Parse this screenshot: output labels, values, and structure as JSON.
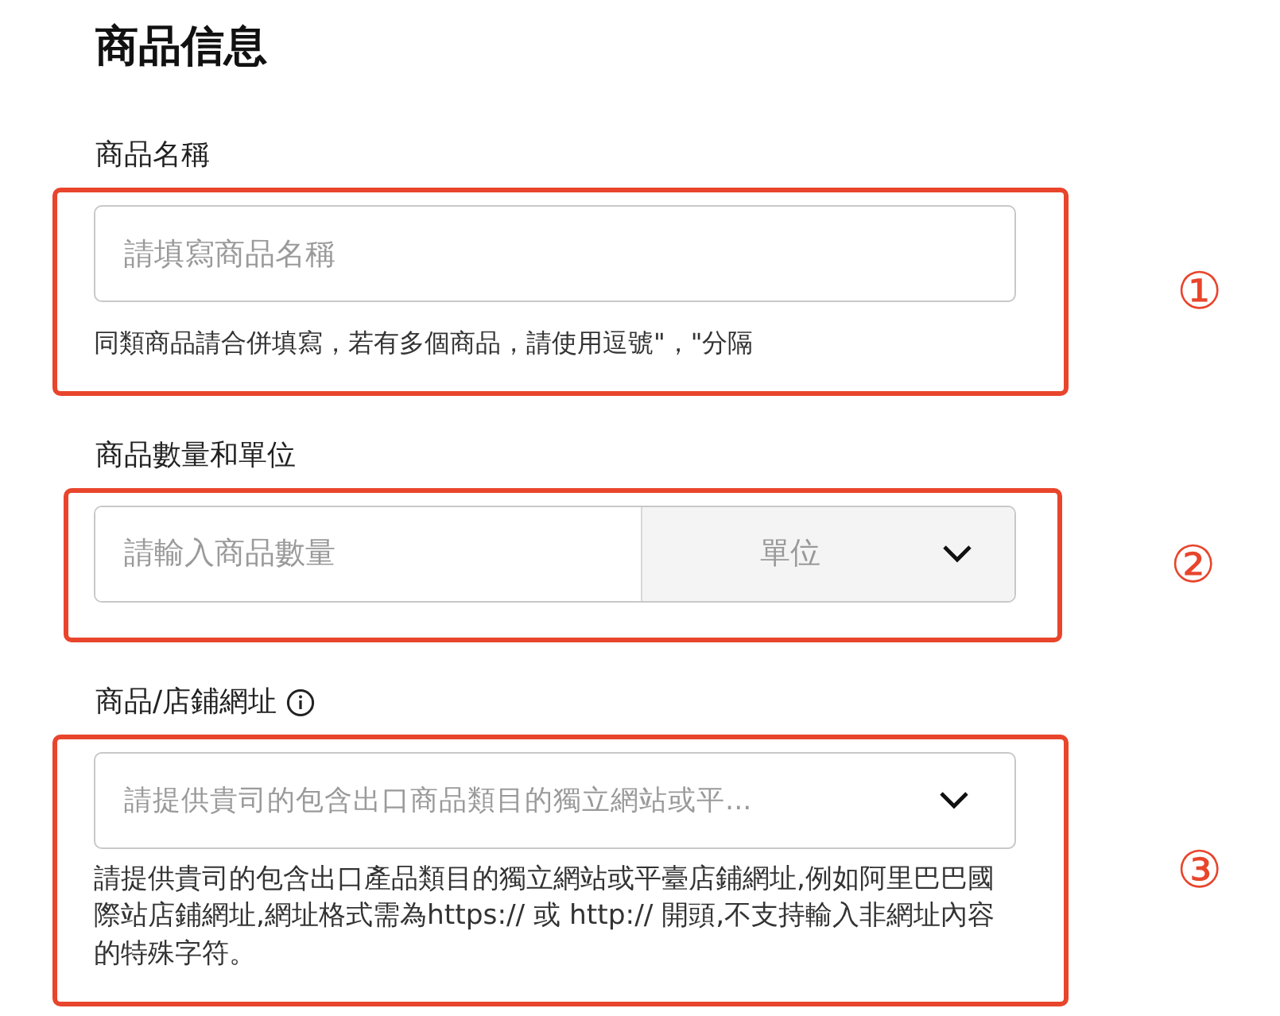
{
  "title": "商品信息",
  "sections": [
    {
      "kind": "text",
      "label": "商品名稱",
      "info": false,
      "placeholder": "請填寫商品名稱",
      "hint": "同類商品請合併填寫，若有多個商品，請使用逗號\"，\"分隔",
      "marker": "①"
    },
    {
      "kind": "quantity",
      "label": "商品數量和單位",
      "info": false,
      "placeholder": "請輸入商品數量",
      "unit": "單位",
      "marker": "②"
    },
    {
      "kind": "select",
      "label": "商品/店鋪網址",
      "info": true,
      "placeholder": "請提供貴司的包含出口商品類目的獨立網站或平...",
      "hint": "請提供貴司的包含出口產品類目的獨立網站或平臺店鋪網址,例如阿里巴巴國際站店鋪網址,網址格式需為https:// 或 http:// 開頭,不支持輸入非網址內容的特殊字符。",
      "marker": "③"
    }
  ]
}
